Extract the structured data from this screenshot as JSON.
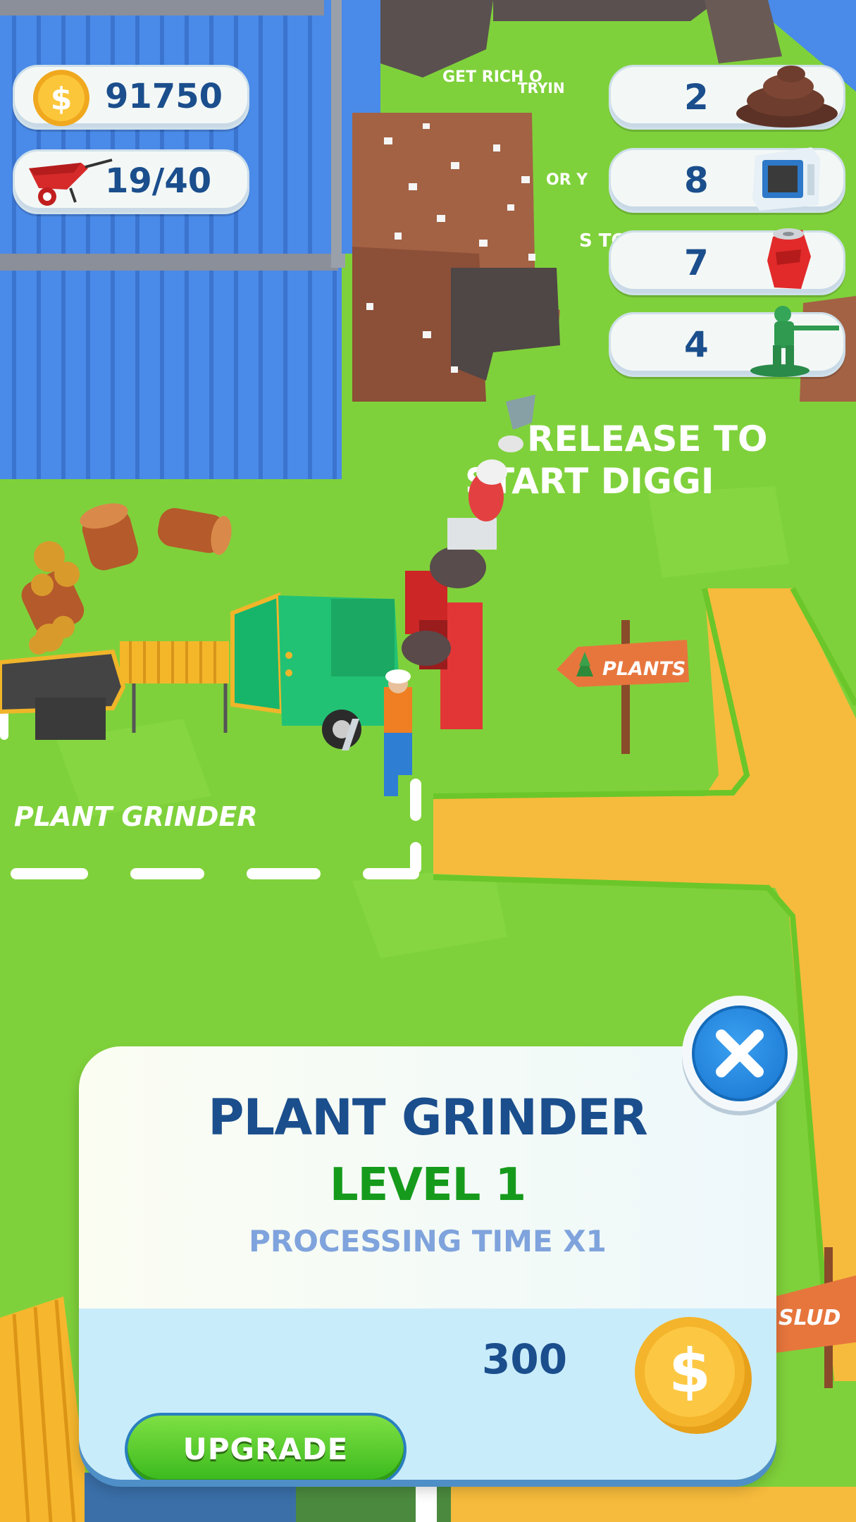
{
  "hud": {
    "coins": "91750",
    "cart_capacity": "19/40",
    "coin_icon": "dollar-coin",
    "cart_icon": "wheelbarrow"
  },
  "inventory": [
    {
      "count": "2",
      "icon": "dirt-pile"
    },
    {
      "count": "8",
      "icon": "microwave"
    },
    {
      "count": "7",
      "icon": "soda-can"
    },
    {
      "count": "4",
      "icon": "toy-soldier"
    }
  ],
  "world": {
    "release_sign_line1": "RELEASE TO",
    "release_sign_line2": "START DIGGI",
    "top_text_1": "GET RICH O",
    "top_text_1b": "TRYIN",
    "top_text_2": "OR Y",
    "top_text_3": "S TO",
    "plants_sign": "PLANTS",
    "plant_grinder_floor": "PLANT GRINDER",
    "sludge_sign": "SLUD"
  },
  "panel": {
    "title": "PLANT GRINDER",
    "level": "LEVEL 1",
    "subtitle": "PROCESSING TIME X1",
    "upgrade_label": "UPGRADE",
    "price": "300",
    "close_icon": "close-x"
  },
  "colors": {
    "grass": "#7fd13b",
    "road": "#f6bb3c",
    "wall_blue": "#4a8ae8",
    "text_blue": "#1b4e8c",
    "level_green": "#169a1c",
    "subtitle_blue": "#7fa3dc",
    "button_green": "#45c222"
  }
}
